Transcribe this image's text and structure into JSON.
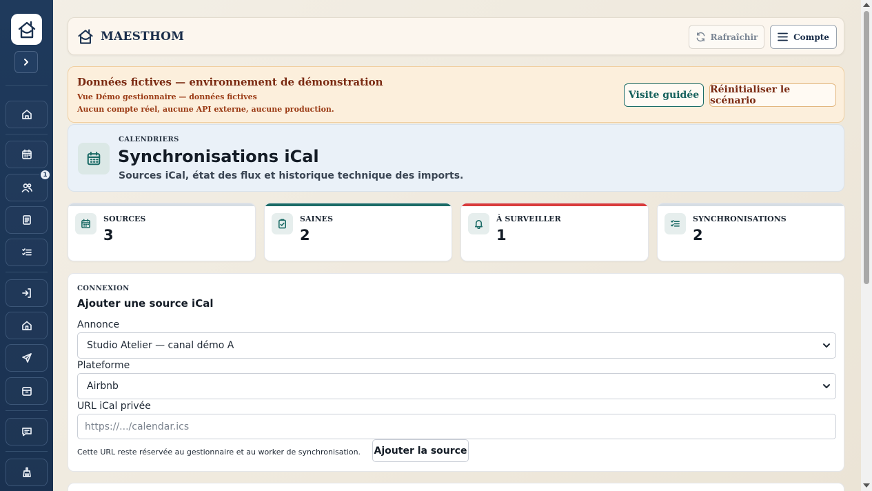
{
  "app": {
    "name": "MAESTHOM"
  },
  "header": {
    "refresh_label": "Rafraîchir",
    "account_label": "Compte"
  },
  "sidebar": {
    "expand_icon": "chevron-right-icon",
    "items": [
      {
        "icon": "home-icon"
      },
      {
        "icon": "calendar-icon"
      },
      {
        "icon": "users-icon",
        "badge": "1"
      },
      {
        "icon": "document-icon"
      },
      {
        "icon": "checklist-icon"
      },
      {
        "icon": "login-icon"
      },
      {
        "icon": "house-icon"
      },
      {
        "icon": "send-icon"
      },
      {
        "icon": "archive-icon"
      },
      {
        "icon": "message-icon"
      },
      {
        "icon": "cleaning-icon"
      }
    ]
  },
  "banner": {
    "title": "Données fictives — environnement de démonstration",
    "line1": "Vue Démo gestionnaire — données fictives",
    "line2": "Aucun compte réel, aucune API externe, aucune production.",
    "tour_label": "Visite guidée",
    "reset_label": "Réinitialiser le scénario"
  },
  "page": {
    "eyebrow": "CALENDRIERS",
    "title": "Synchronisations iCal",
    "subtitle": "Sources iCal, état des flux et historique technique des imports."
  },
  "stats": [
    {
      "label": "SOURCES",
      "value": "3",
      "accent": "#d6dde4",
      "icon": "calendar-icon"
    },
    {
      "label": "SAINES",
      "value": "2",
      "accent": "#1b6b66",
      "icon": "clipboard-check-icon"
    },
    {
      "label": "À SURVEILLER",
      "value": "1",
      "accent": "#d93b3b",
      "icon": "bell-icon"
    },
    {
      "label": "SYNCHRONISATIONS",
      "value": "2",
      "accent": "#d6dde4",
      "icon": "list-check-icon"
    }
  ],
  "form": {
    "eyebrow": "CONNEXION",
    "title": "Ajouter une source iCal",
    "listing_label": "Annonce",
    "listing_value": "Studio Atelier — canal démo A",
    "platform_label": "Plateforme",
    "platform_value": "Airbnb",
    "url_label": "URL iCal privée",
    "url_placeholder": "https://.../calendar.ics",
    "help": "Cette URL reste réservée au gestionnaire et au worker de synchronisation.",
    "submit_label": "Ajouter la source"
  },
  "colors": {
    "sidebar": "#1f3a5c",
    "accent": "#1b6b66",
    "warning": "#d93b3b",
    "brand": "#1a2e4a"
  }
}
